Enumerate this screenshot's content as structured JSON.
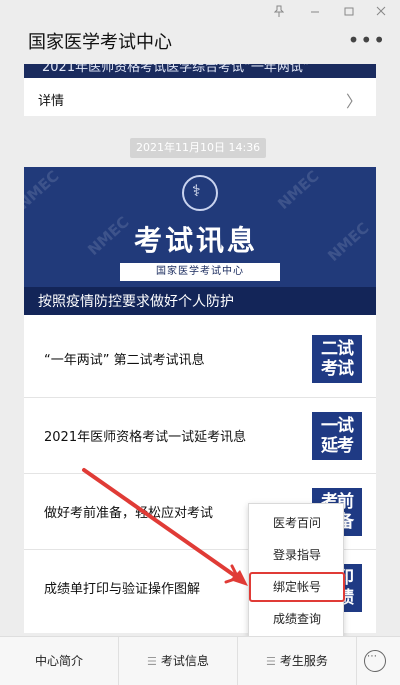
{
  "window": {
    "title": "国家医学考试中心",
    "controls": [
      "pin-icon",
      "minimize-icon",
      "maximize-icon",
      "close-icon"
    ]
  },
  "previous_card": {
    "banner_text": "2021年医师资格考试医学综合考试“一年两试”",
    "detail_label": "详情"
  },
  "timestamp": "2021年11月10日 14:36",
  "news": {
    "hero": {
      "headline": "考试讯息",
      "org_box": "国家医学考试中心",
      "caption": "按照疫情防控要求做好个人防护",
      "watermark": "NMEC"
    },
    "items": [
      {
        "title": "“一年两试” 第二试考试讯息",
        "thumb": [
          "二试",
          "考试"
        ]
      },
      {
        "title": "2021年医师资格考试一试延考讯息",
        "thumb": [
          "一试",
          "延考"
        ]
      },
      {
        "title": "做好考前准备，轻松应对考试",
        "thumb": [
          "考前",
          "准备"
        ]
      },
      {
        "title": "成绩单打印与验证操作图解",
        "thumb": [
          "打印",
          "成绩"
        ]
      }
    ]
  },
  "popup_menu": {
    "items": [
      "医考百问",
      "登录指导",
      "绑定帐号",
      "成绩查询"
    ],
    "highlighted_index": 2
  },
  "bottom_nav": {
    "tabs": [
      "中心简介",
      "考试信息",
      "考生服务"
    ],
    "menu_glyph": "☰",
    "active_tab": "考生服务",
    "keyboard_icon": "keyboard-icon"
  },
  "colors": {
    "navy": "#213a7a",
    "annotation_red": "#e03b36"
  }
}
